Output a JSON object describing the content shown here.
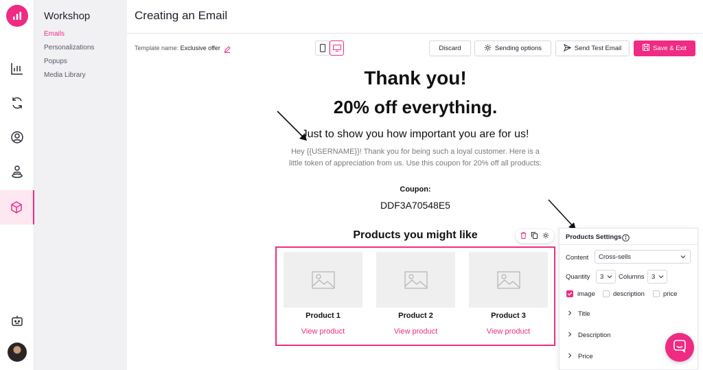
{
  "sidebar": {
    "title": "Workshop",
    "items": [
      "Emails",
      "Personalizations",
      "Popups",
      "Media Library"
    ]
  },
  "rail": {
    "icons": [
      "chart-icon",
      "sync-icon",
      "user-circle-icon",
      "person-pin-icon",
      "box-icon",
      "bot-icon"
    ],
    "active": "box-icon"
  },
  "header": {
    "title": "Creating an Email"
  },
  "toolbar": {
    "template_label": "Template name:",
    "template_name": "Exclusive offer",
    "discard": "Discard",
    "sending_options": "Sending options",
    "send_test": "Send Test Email",
    "save_exit": "Save & Exit",
    "active_view": "desktop"
  },
  "email": {
    "heading1": "Thank you!",
    "heading2": "20% off everything.",
    "subtitle": "Just to show you how important you are for us!",
    "body": "Hey {{USERNAME}}! Thank you for being such a loyal customer. Here is a little token of appreciation from us. Use this coupon for 20% off all products:",
    "coupon_label": "Coupon:",
    "coupon_code": "DDF3A70548E5",
    "products_title": "Products you might like",
    "products": [
      {
        "name": "Product 1",
        "link": "View product"
      },
      {
        "name": "Product 2",
        "link": "View product"
      },
      {
        "name": "Product 3",
        "link": "View product"
      }
    ]
  },
  "panel": {
    "title": "Products Settings",
    "content_label": "Content",
    "content_value": "Cross-sells",
    "quantity_label": "Quantity",
    "quantity_value": "3",
    "columns_label": "Columns",
    "columns_value": "3",
    "checkboxes": [
      {
        "label": "image",
        "checked": true
      },
      {
        "label": "description",
        "checked": false
      },
      {
        "label": "price",
        "checked": false
      }
    ],
    "sections": [
      "Title",
      "Description",
      "Price"
    ]
  },
  "colors": {
    "accent": "#ef2b83",
    "subnav_bg": "#f1f1f4"
  }
}
